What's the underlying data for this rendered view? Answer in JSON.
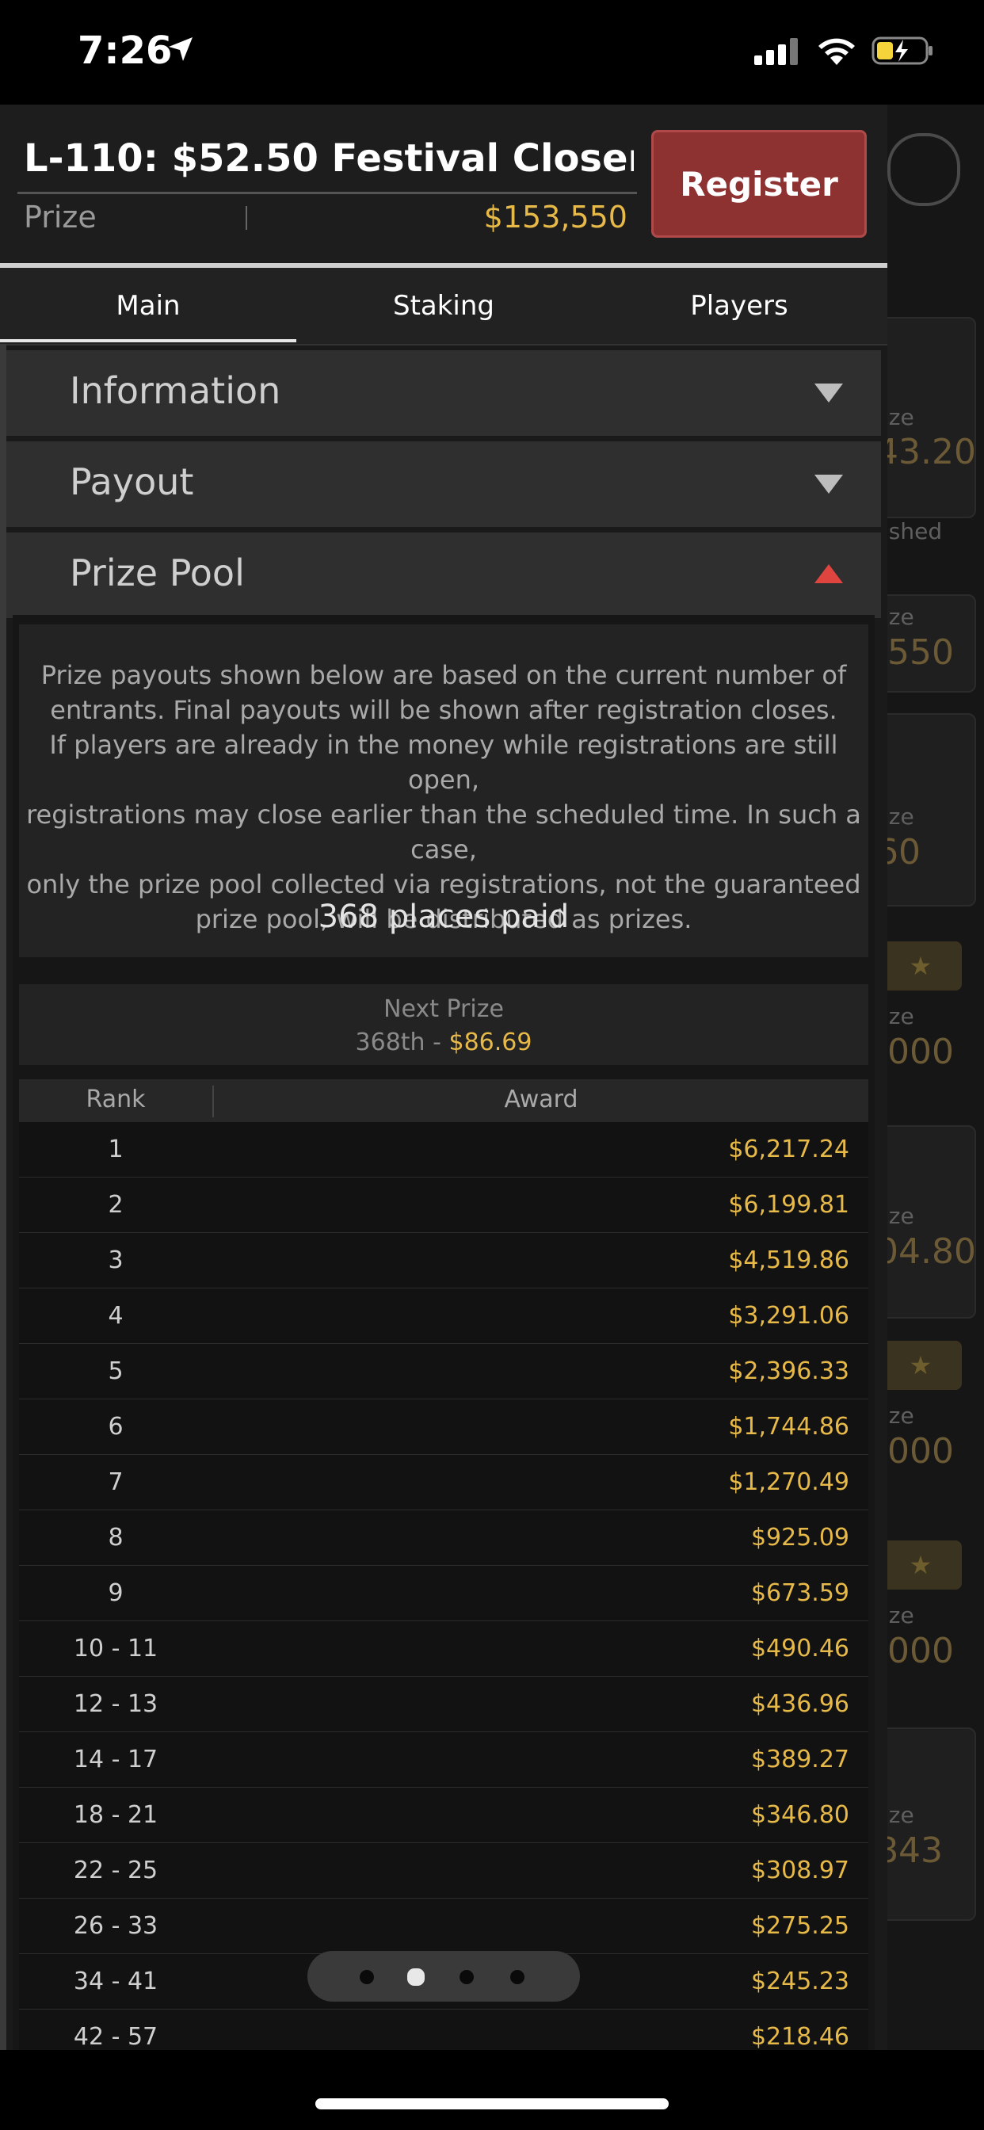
{
  "status_bar": {
    "time": "7:26"
  },
  "header": {
    "title": "L-110: $52.50 Festival Closer [Bounty Builder]",
    "prize_label": "Prize",
    "prize_value": "$153,550",
    "register_label": "Register"
  },
  "tabs": [
    {
      "label": "Main",
      "active": true
    },
    {
      "label": "Staking",
      "active": false
    },
    {
      "label": "Players",
      "active": false
    }
  ],
  "sections": [
    {
      "label": "Information",
      "expanded": false
    },
    {
      "label": "Payout",
      "expanded": false
    },
    {
      "label": "Prize Pool",
      "expanded": true
    }
  ],
  "prize_pool": {
    "notice_lines": [
      "Prize payouts shown below are based on the current number of",
      "entrants. Final payouts will be shown after registration closes.",
      "If players are already in the money while registrations are still open,",
      "registrations may close earlier than the scheduled time. In such a case,",
      "only the prize pool collected via registrations, not the guaranteed",
      "prize pool, will be distributed as prizes."
    ],
    "places_paid": "368 places paid",
    "next_prize_label": "Next Prize",
    "next_prize_rank": "368th",
    "next_prize_sep": " - ",
    "next_prize_value": "$86.69",
    "column_rank": "Rank",
    "column_award": "Award",
    "rows": [
      {
        "rank": "1",
        "award": "$6,217.24"
      },
      {
        "rank": "2",
        "award": "$6,199.81"
      },
      {
        "rank": "3",
        "award": "$4,519.86"
      },
      {
        "rank": "4",
        "award": "$3,291.06"
      },
      {
        "rank": "5",
        "award": "$2,396.33"
      },
      {
        "rank": "6",
        "award": "$1,744.86"
      },
      {
        "rank": "7",
        "award": "$1,270.49"
      },
      {
        "rank": "8",
        "award": "$925.09"
      },
      {
        "rank": "9",
        "award": "$673.59"
      },
      {
        "rank": "10 - 11",
        "award": "$490.46"
      },
      {
        "rank": "12 - 13",
        "award": "$436.96"
      },
      {
        "rank": "14 - 17",
        "award": "$389.27"
      },
      {
        "rank": "18 - 21",
        "award": "$346.80"
      },
      {
        "rank": "22 - 25",
        "award": "$308.97"
      },
      {
        "rank": "26 - 33",
        "award": "$275.25"
      },
      {
        "rank": "34 - 41",
        "award": "$245.23"
      },
      {
        "rank": "42 - 57",
        "award": "$218.46"
      }
    ]
  },
  "background": {
    "labels": [
      "ize",
      "ished",
      "ize",
      "ize",
      "ize",
      "ize",
      "ize",
      "ize",
      "ize",
      "ize"
    ],
    "values": [
      "43.20",
      ",550",
      "60",
      ",000",
      "04.80",
      ",000",
      ",000",
      "843"
    ]
  },
  "pager": {
    "pages": 4,
    "active_index": 1
  },
  "colors": {
    "accent_gold": "#e7b949",
    "register_red": "#8e3131",
    "expand_arrow_red": "#e0443f"
  }
}
